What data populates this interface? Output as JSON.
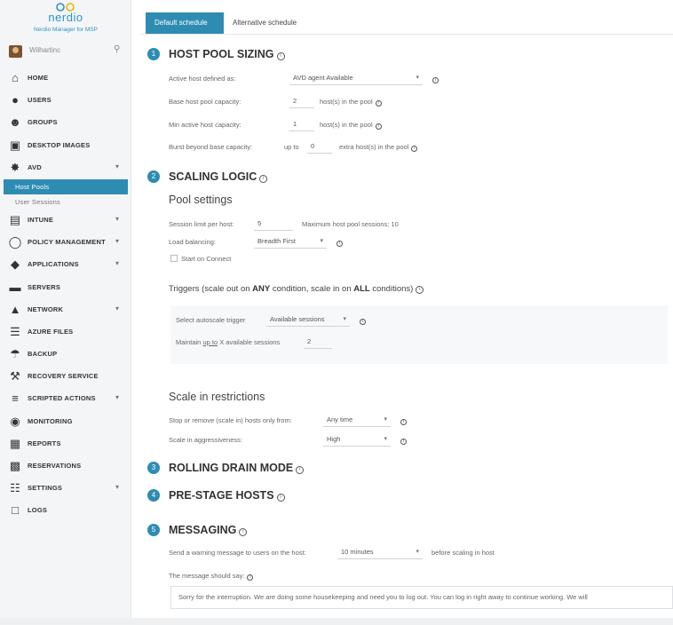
{
  "brand": {
    "logo_text": "nerdio",
    "subtitle": "Nerdio Manager for MSP"
  },
  "user": {
    "name": "Wilhartinc"
  },
  "nav": {
    "home": "HOME",
    "users": "USERS",
    "groups": "GROUPS",
    "desktop_images": "DESKTOP IMAGES",
    "avd": "AVD",
    "host_pools": "Host Pools",
    "user_sessions": "User Sessions",
    "intune": "INTUNE",
    "policy_management": "POLICY MANAGEMENT",
    "applications": "APPLICATIONS",
    "servers": "SERVERS",
    "network": "NETWORK",
    "azure_files": "AZURE FILES",
    "backup": "BACKUP",
    "recovery_service": "RECOVERY SERVICE",
    "scripted_actions": "SCRIPTED ACTIONS",
    "monitoring": "MONITORING",
    "reports": "REPORTS",
    "reservations": "RESERVATIONS",
    "settings": "SETTINGS",
    "logs": "LOGS"
  },
  "tabs": {
    "default": "Default schedule",
    "alternative": "Alternative schedule"
  },
  "sizing": {
    "num": "1",
    "title": "HOST POOL SIZING",
    "active_host_label": "Active host defined as:",
    "active_host_value": "AVD agent Available",
    "base_capacity_label": "Base host pool capacity:",
    "base_capacity_value": "2",
    "base_capacity_suffix": "host(s) in the pool",
    "min_active_label": "Min active host capacity:",
    "min_active_value": "1",
    "min_active_suffix": "host(s) in the pool",
    "burst_label": "Burst beyond base capacity:",
    "burst_prefix": "up to",
    "burst_value": "0",
    "burst_suffix": "extra host(s) in the pool"
  },
  "scaling": {
    "num": "2",
    "title": "SCALING LOGIC",
    "pool_settings": "Pool settings",
    "session_limit_label": "Session limit per host:",
    "session_limit_value": "5",
    "max_sessions_text": "Maximum host pool sessions: 10",
    "load_balancing_label": "Load balancing:",
    "load_balancing_value": "Breadth First",
    "start_on_connect": "Start on Connect",
    "triggers_prefix": "Triggers (scale out on ",
    "triggers_any": "ANY",
    "triggers_mid": " condition, scale in on ",
    "triggers_all": "ALL",
    "triggers_suffix": " conditions)",
    "select_trigger_label": "Select autoscale trigger",
    "select_trigger_value": "Available sessions",
    "maintain_prefix": "Maintain ",
    "maintain_upto": "up to",
    "maintain_suffix": " X available sessions",
    "maintain_value": "2",
    "scale_in_title": "Scale in restrictions",
    "stop_label": "Stop or remove (scale in) hosts only from:",
    "stop_value": "Any time",
    "aggressiveness_label": "Scale in aggressiveness:",
    "aggressiveness_value": "High"
  },
  "rolling": {
    "num": "3",
    "title": "ROLLING DRAIN MODE"
  },
  "prestage": {
    "num": "4",
    "title": "PRE-STAGE HOSTS"
  },
  "messaging": {
    "num": "5",
    "title": "MESSAGING",
    "send_label": "Send a warning message to users on the host:",
    "send_value": "10 minutes",
    "send_suffix": "before scaling in host",
    "message_label": "The message should say:",
    "message_text": "Sorry for the interruption. We are doing some housekeeping and need you to log out. You can log in right away to continue working. We will"
  }
}
